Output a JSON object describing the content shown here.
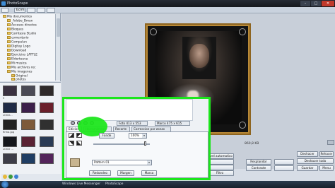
{
  "window": {
    "title": "PhotoScape",
    "min": "–",
    "max": "□",
    "close": "✕"
  },
  "menubar": {
    "items": [
      "",
      "Ecrm",
      "",
      "",
      "",
      "",
      ""
    ]
  },
  "explorer": {
    "items": [
      "Mis documentos",
      "_Adobe_Bman",
      "Accesos directos",
      "Bloques",
      "Camtasia Studio",
      "comentario",
      "Compulun",
      "Digitay Logo",
      "Download",
      "Ejercicios LATTLE",
      "Elderteuva",
      "Mi musica",
      "Mis archivos rec",
      "Mis imagenes",
      "Original",
      "photos"
    ]
  },
  "thumbs": {
    "labels": [
      "5",
      "LOGO...",
      "",
      "firma.jpg",
      "",
      "LOGO ...",
      "",
      "",
      ""
    ]
  },
  "canvas": {
    "filename": "Sin titulo element.bmp",
    "zoom": "860,8 KB"
  },
  "size_tabs": [
    "Foto 413 x 553",
    "Marco 475 x 615"
  ],
  "panel": {
    "tabs": [
      "Edicion",
      "Herramientas",
      "Recorte",
      "Correccion por zonas"
    ],
    "fonde": "Fonde",
    "percent": "100%",
    "pattern": "Pattern 01",
    "buttons": [
      "Redondeo",
      "Margen",
      "Marco"
    ]
  },
  "right_buttons": {
    "col1": [
      "Nivel automatico",
      "Redimensionar",
      "Ajustes",
      "Filtro"
    ],
    "col2": [
      "Resplandor",
      "Contraste",
      "Perfilado",
      "Filtro"
    ],
    "col3": [
      "Deshacer",
      "Deshacer todo",
      "Guardar"
    ],
    "col4": [
      "Rehacer",
      "Menu"
    ]
  },
  "taskbar": {
    "tasks": [
      "Windows Live Messenger",
      "PhotoScape"
    ]
  }
}
